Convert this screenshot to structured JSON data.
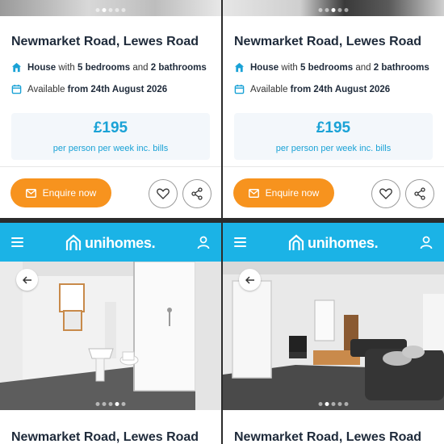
{
  "listings": [
    {
      "title": "Newmarket Road, Lewes Road",
      "house_prefix": "House",
      "house_mid": " with ",
      "bedrooms": "5 bedrooms",
      "and": " and ",
      "bathrooms": "2 bathrooms",
      "available_prefix": "Available ",
      "available_date": "from 24th August 2026",
      "price": "£195",
      "price_note": "per person per week inc. bills",
      "enquire_label": "Enquire now",
      "gallery_dots": 5,
      "active_dot": 2
    },
    {
      "title": "Newmarket Road, Lewes Road",
      "house_prefix": "House",
      "house_mid": " with ",
      "bedrooms": "5 bedrooms",
      "and": " and ",
      "bathrooms": "2 bathrooms",
      "available_prefix": "Available ",
      "available_date": "from 24th August 2026",
      "price": "£195",
      "price_note": "per person per week inc. bills",
      "enquire_label": "Enquire now",
      "gallery_dots": 5,
      "active_dot": 3
    }
  ],
  "detail_views": [
    {
      "brand": "unihomes.",
      "title": "Newmarket Road, Lewes Road",
      "photo": "bathroom",
      "gallery_dots": 5,
      "active_dot": 3
    },
    {
      "brand": "unihomes.",
      "title": "Newmarket Road, Lewes Road",
      "photo": "living-room",
      "gallery_dots": 5,
      "active_dot": 1
    }
  ],
  "colors": {
    "brand_blue": "#1bb3e6",
    "price_blue": "#1aa2d6",
    "enquire_orange": "#f7931e",
    "title_navy": "#1e2a3a"
  },
  "icons": [
    "house-icon",
    "calendar-icon",
    "mail-icon",
    "heart-icon",
    "share-icon",
    "menu-icon",
    "user-icon",
    "back-arrow-icon",
    "house-logo-icon"
  ]
}
